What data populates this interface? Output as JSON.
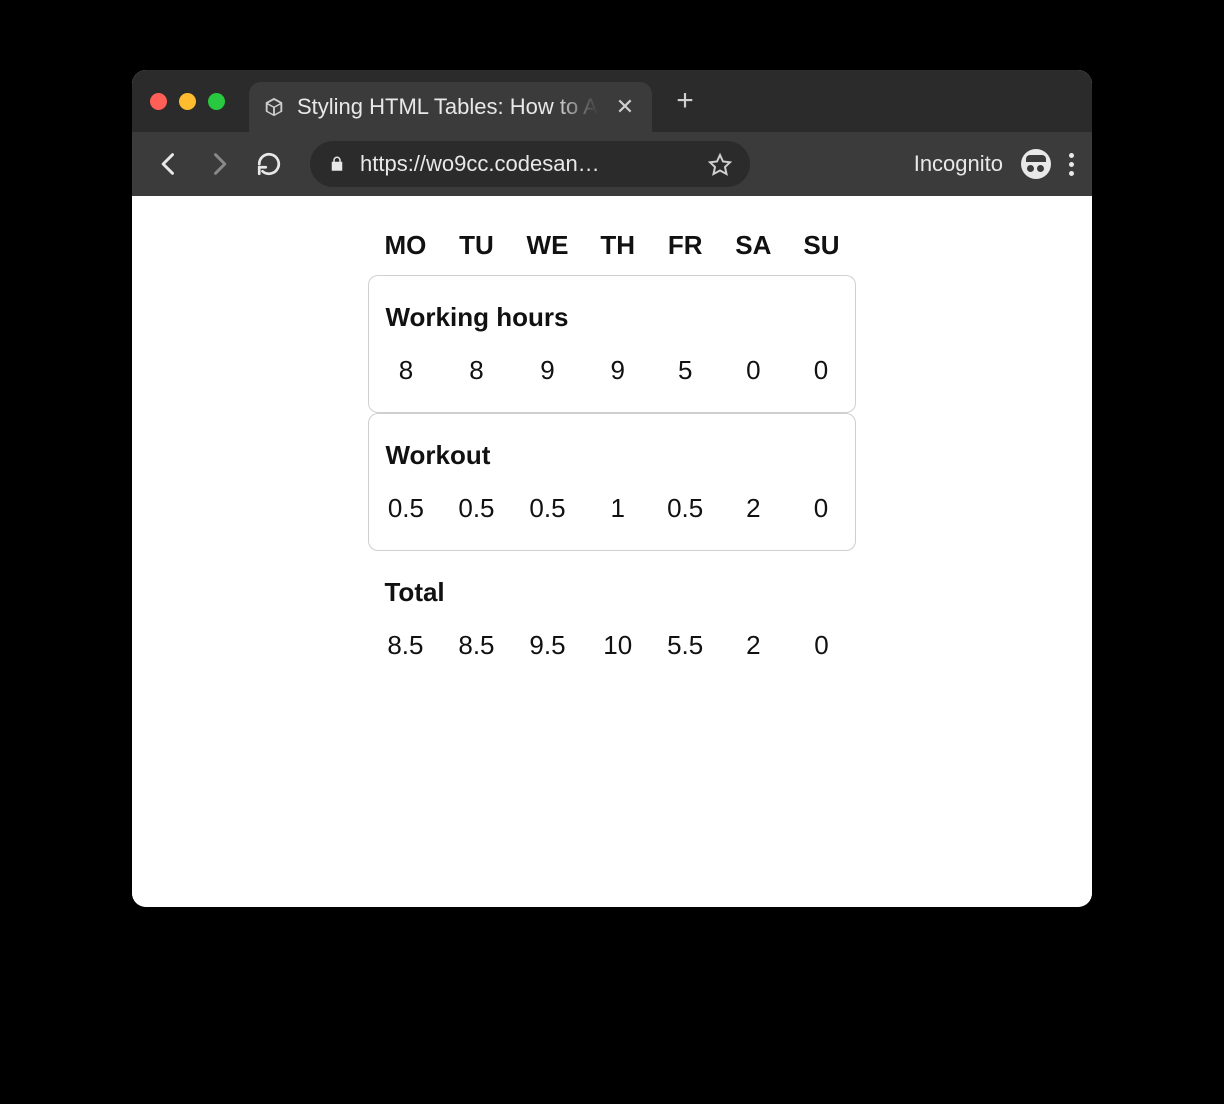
{
  "browser": {
    "tab_title": "Styling HTML Tables: How to A",
    "url_display": "https://wo9cc.codesan…",
    "mode_label": "Incognito"
  },
  "chart_data": {
    "type": "table",
    "title": "",
    "categories": [
      "MO",
      "TU",
      "WE",
      "TH",
      "FR",
      "SA",
      "SU"
    ],
    "series": [
      {
        "name": "Working hours",
        "values": [
          8,
          8,
          9,
          9,
          5,
          0,
          0
        ]
      },
      {
        "name": "Workout",
        "values": [
          0.5,
          0.5,
          0.5,
          1,
          0.5,
          2,
          0
        ]
      },
      {
        "name": "Total",
        "values": [
          8.5,
          8.5,
          9.5,
          10,
          5.5,
          2,
          0
        ]
      }
    ]
  }
}
